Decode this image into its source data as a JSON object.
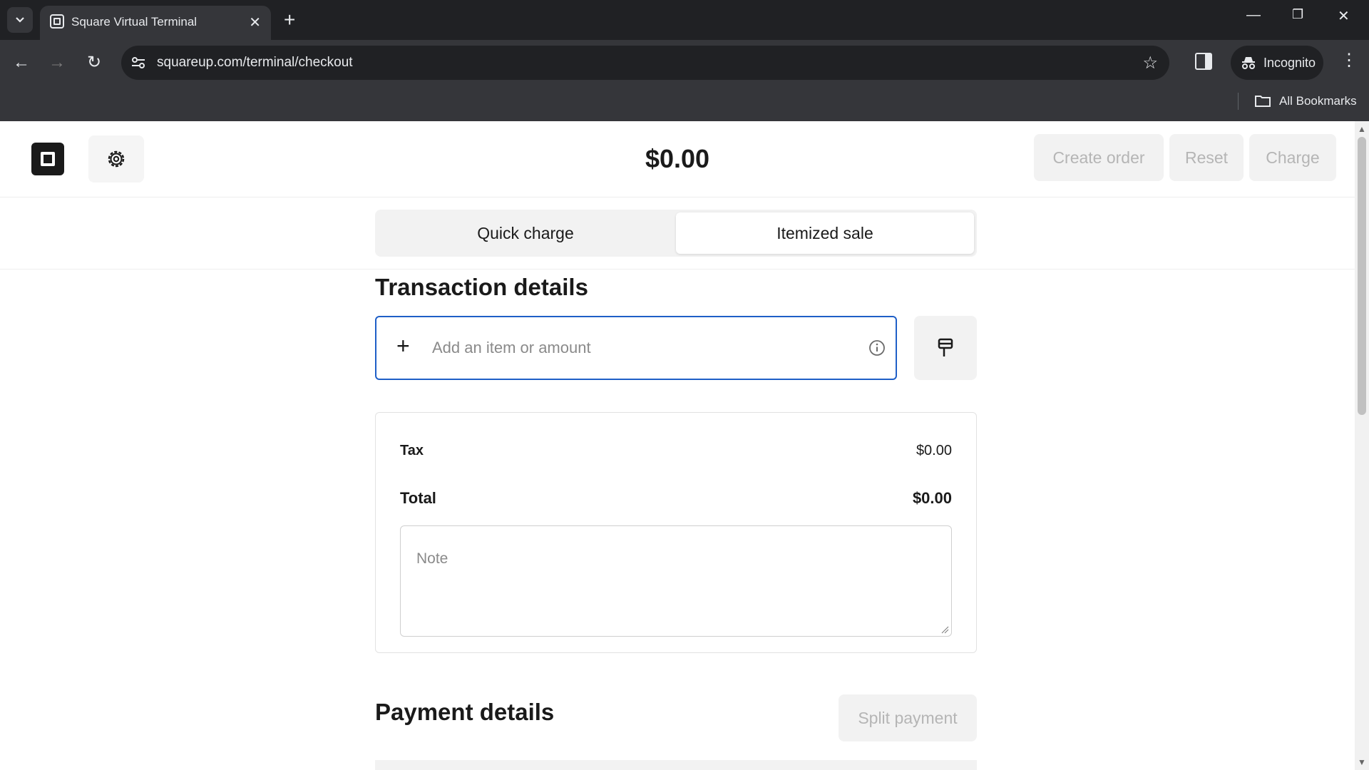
{
  "browser": {
    "tab_title": "Square Virtual Terminal",
    "url": "squareup.com/terminal/checkout",
    "incognito_label": "Incognito",
    "bookmarks_label": "All Bookmarks"
  },
  "header": {
    "amount": "$0.00",
    "create_order": "Create order",
    "reset": "Reset",
    "charge": "Charge"
  },
  "mode_tabs": [
    {
      "label": "Quick charge",
      "active": false
    },
    {
      "label": "Itemized sale",
      "active": true
    }
  ],
  "transaction": {
    "title": "Transaction details",
    "add_placeholder": "Add an item or amount",
    "tax_label": "Tax",
    "tax_value": "$0.00",
    "total_label": "Total",
    "total_value": "$0.00",
    "note_placeholder": "Note"
  },
  "payment": {
    "title": "Payment details",
    "split_label": "Split payment"
  },
  "colors": {
    "accent": "#1f5fc7",
    "chrome_dark": "#202124",
    "disabled_text": "#b5b5b5"
  }
}
